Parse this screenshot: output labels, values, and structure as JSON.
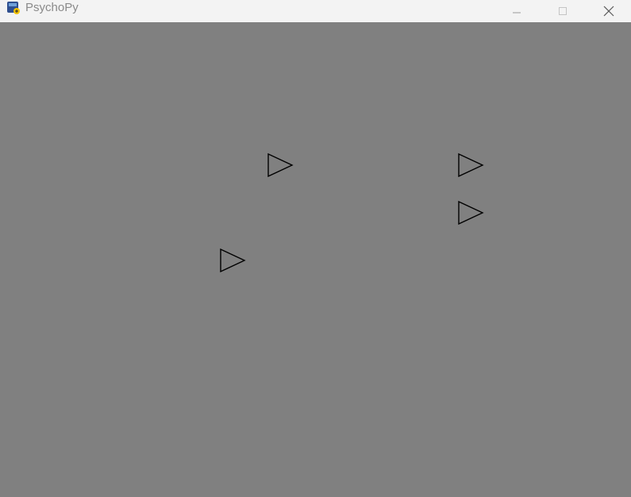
{
  "window": {
    "title": "PsychoPy",
    "app_icon": "psychopy-app-icon",
    "controls": {
      "minimize_icon": "minimize-icon",
      "maximize_icon": "maximize-icon",
      "close_icon": "close-icon"
    }
  },
  "stage": {
    "background_color": "#808080",
    "stimuli": [
      {
        "name": "right-arrow-triangle-1",
        "icon": "right-pointing-triangle-outline"
      },
      {
        "name": "right-arrow-triangle-2",
        "icon": "right-pointing-triangle-outline"
      },
      {
        "name": "right-arrow-triangle-3",
        "icon": "right-pointing-triangle-outline"
      },
      {
        "name": "right-arrow-triangle-4",
        "icon": "right-pointing-triangle-outline"
      }
    ],
    "stroke_color": "#000000"
  }
}
